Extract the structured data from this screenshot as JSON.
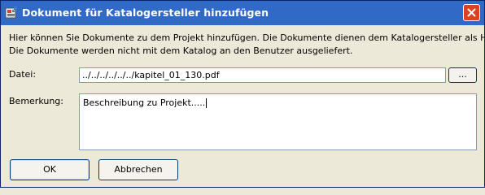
{
  "window": {
    "title": "Dokument für Katalogersteller hinzufügen",
    "icon": "catalog-app-icon",
    "close_icon": "close-icon",
    "accent_color": "#3169c6",
    "close_color": "#d9431f"
  },
  "description": {
    "line1": "Hier können Sie Dokumente zu dem Projekt hinzufügen. Die Dokumente dienen dem Katalogersteller als Hilfe.",
    "line2": "Die Dokumente werden nicht mit dem Katalog an den Benutzer ausgeliefert."
  },
  "file": {
    "label": "Datei:",
    "value": "../../../../../../kapitel_01_130.pdf",
    "browse_label": "..."
  },
  "remark": {
    "label": "Bemerkung:",
    "value": "Beschreibung zu Projekt....."
  },
  "buttons": {
    "ok": "OK",
    "cancel": "Abbrechen"
  }
}
